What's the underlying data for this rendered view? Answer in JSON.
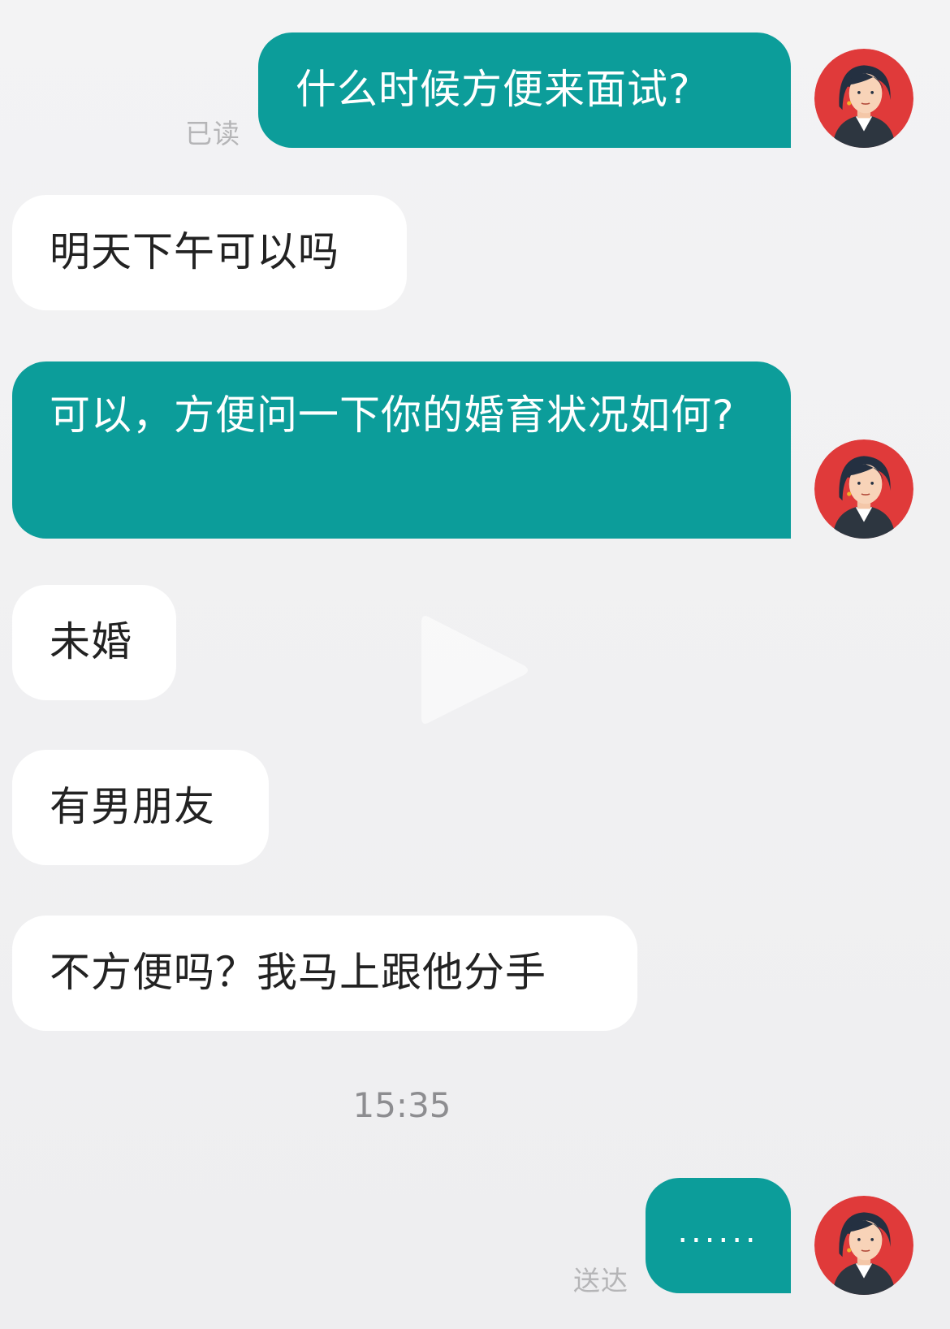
{
  "messages": [
    {
      "text": "什么时候方便来面试?",
      "status": "已读"
    },
    {
      "text": "明天下午可以吗"
    },
    {
      "text": "可以，方便问一下你的婚育状况如何?"
    },
    {
      "text": "未婚"
    },
    {
      "text": "有男朋友"
    },
    {
      "text": "不方便吗？我马上跟他分手"
    },
    {
      "text": "......",
      "status": "送达"
    }
  ],
  "timestamp": "15:35",
  "colors": {
    "sent_bubble": "#0c9d9a",
    "received_bubble": "#ffffff",
    "background": "#f2f2f3",
    "avatar_bg": "#e03a3a"
  },
  "icons": {
    "avatar": "woman-avatar-icon",
    "play": "play-icon"
  }
}
